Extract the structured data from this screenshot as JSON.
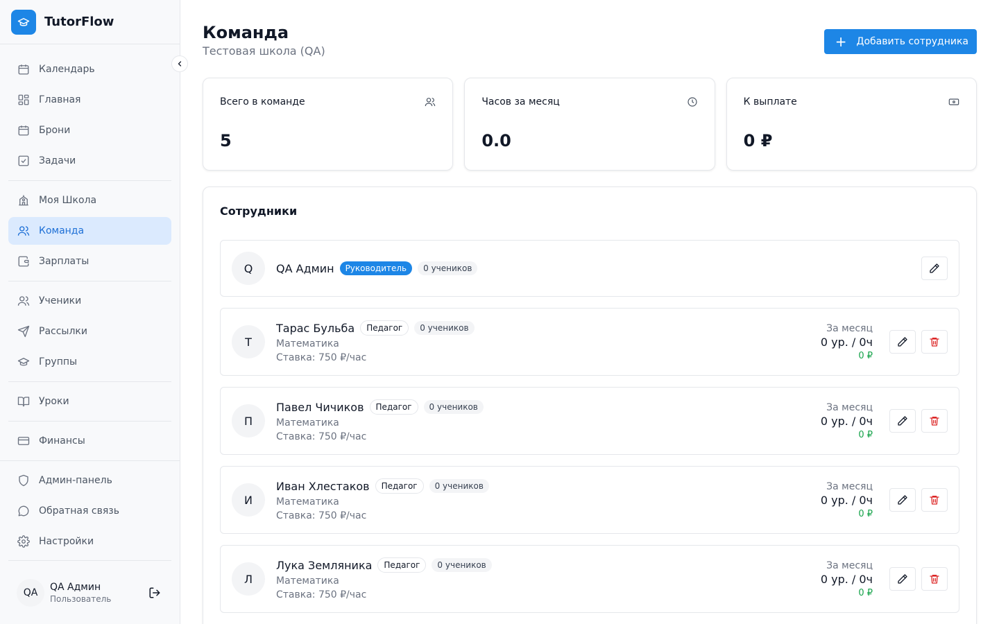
{
  "app": {
    "name": "TutorFlow"
  },
  "sidebar": {
    "items": [
      {
        "label": "Календарь",
        "icon": "calendar-icon"
      },
      {
        "label": "Главная",
        "icon": "dashboard-icon"
      },
      {
        "label": "Брони",
        "icon": "calendar-icon"
      },
      {
        "label": "Задачи",
        "icon": "checkbox-icon"
      },
      {
        "label": "Моя Школа",
        "icon": "school-icon"
      },
      {
        "label": "Команда",
        "icon": "users-icon",
        "active": true
      },
      {
        "label": "Зарплаты",
        "icon": "wallet-icon"
      },
      {
        "label": "Ученики",
        "icon": "users-icon"
      },
      {
        "label": "Рассылки",
        "icon": "send-icon"
      },
      {
        "label": "Группы",
        "icon": "graduation-cap-icon"
      },
      {
        "label": "Уроки",
        "icon": "book-icon"
      },
      {
        "label": "Финансы",
        "icon": "credit-card-icon"
      },
      {
        "label": "Админ-панель",
        "icon": "shield-icon"
      },
      {
        "label": "Обратная связь",
        "icon": "message-icon"
      },
      {
        "label": "Настройки",
        "icon": "gear-icon"
      }
    ],
    "user": {
      "initials": "QA",
      "name": "QA Админ",
      "role": "Пользователь"
    }
  },
  "header": {
    "title": "Команда",
    "subtitle": "Тестовая школа (QA)",
    "add_button": "Добавить сотрудника"
  },
  "stats": [
    {
      "label": "Всего в команде",
      "value": "5",
      "icon": "users-icon"
    },
    {
      "label": "Часов за месяц",
      "value": "0.0",
      "icon": "clock-icon"
    },
    {
      "label": "К выплате",
      "value": "0 ₽",
      "icon": "banknote-icon"
    }
  ],
  "staff": {
    "title": "Сотрудники",
    "head": {
      "initial": "Q",
      "name": "QA Админ",
      "role": "Руководитель",
      "students": "0 учеников"
    },
    "members": [
      {
        "initial": "Т",
        "name": "Тарас Бульба",
        "role": "Педагог",
        "students": "0 учеников",
        "subject": "Математика",
        "rate": "Ставка: 750 ₽/час",
        "month_label": "За месяц",
        "month_value": "0 ур. / 0ч",
        "month_money": "0 ₽"
      },
      {
        "initial": "П",
        "name": "Павел Чичиков",
        "role": "Педагог",
        "students": "0 учеников",
        "subject": "Математика",
        "rate": "Ставка: 750 ₽/час",
        "month_label": "За месяц",
        "month_value": "0 ур. / 0ч",
        "month_money": "0 ₽"
      },
      {
        "initial": "И",
        "name": "Иван Хлестаков",
        "role": "Педагог",
        "students": "0 учеников",
        "subject": "Математика",
        "rate": "Ставка: 750 ₽/час",
        "month_label": "За месяц",
        "month_value": "0 ур. / 0ч",
        "month_money": "0 ₽"
      },
      {
        "initial": "Л",
        "name": "Лука Земляника",
        "role": "Педагог",
        "students": "0 учеников",
        "subject": "Математика",
        "rate": "Ставка: 750 ₽/час",
        "month_label": "За месяц",
        "month_value": "0 ур. / 0ч",
        "month_money": "0 ₽"
      }
    ]
  },
  "colors": {
    "accent": "#1d86e6",
    "active_bg": "#dbeafe",
    "money": "#16a34a",
    "danger": "#dc2626"
  }
}
